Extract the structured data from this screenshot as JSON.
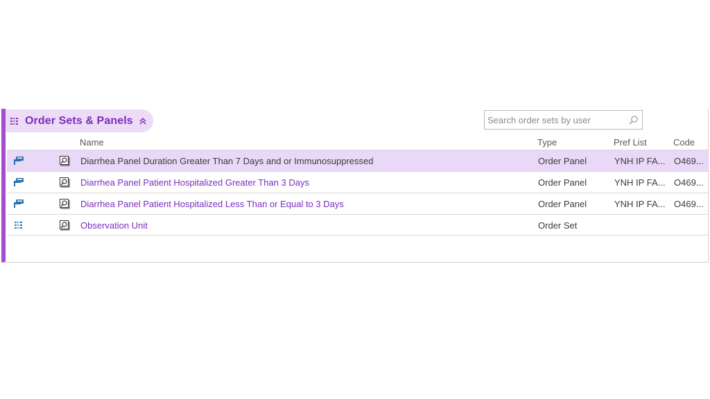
{
  "section": {
    "title": "Order Sets & Panels",
    "icon": "list-tree-icon",
    "collapse_icon": "chevron-double-up-icon"
  },
  "search": {
    "placeholder": "Search order sets by user",
    "value": "",
    "icon": "search-icon"
  },
  "columns": {
    "name": "Name",
    "type": "Type",
    "pref_list": "Pref List",
    "code": "Code"
  },
  "rows": [
    {
      "icon": "order-panel-icon",
      "name": "Diarrhea Panel Duration Greater Than 7 Days and or Immunosuppressed",
      "type": "Order Panel",
      "pref_list": "YNH IP FA...",
      "code": "O469...",
      "selected": true
    },
    {
      "icon": "order-panel-icon",
      "name": "Diarrhea Panel Patient Hospitalized Greater Than 3 Days",
      "type": "Order Panel",
      "pref_list": "YNH IP FA...",
      "code": "O469...",
      "selected": false
    },
    {
      "icon": "order-panel-icon",
      "name": "Diarrhea Panel Patient Hospitalized Less Than or Equal to 3 Days",
      "type": "Order Panel",
      "pref_list": "YNH IP FA...",
      "code": "O469...",
      "selected": false
    },
    {
      "icon": "order-set-icon",
      "name": "Observation Unit",
      "type": "Order Set",
      "pref_list": "",
      "code": "",
      "selected": false
    }
  ],
  "colors": {
    "accent": "#a64ccf",
    "link": "#7b2cbf",
    "selected_row": "#ead8f8",
    "tab_bg": "#eddcf6",
    "icon_blue": "#2f6fa8"
  }
}
